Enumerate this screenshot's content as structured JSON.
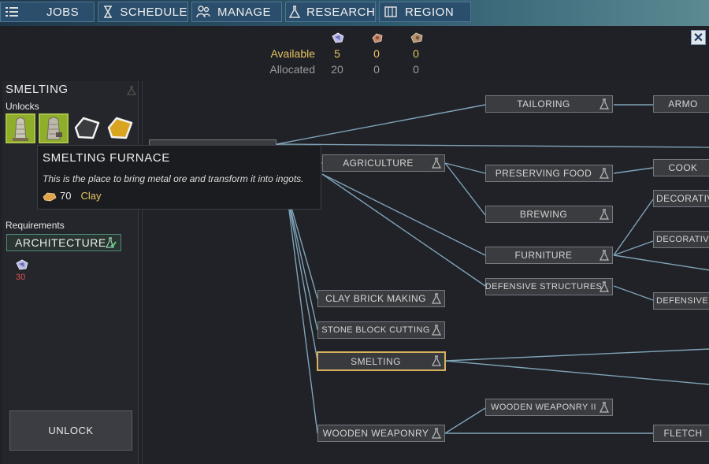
{
  "nav": {
    "items": [
      {
        "label": "JOBS",
        "icon": "list-icon"
      },
      {
        "label": "SCHEDULE",
        "icon": "hourglass-icon"
      },
      {
        "label": "MANAGE",
        "icon": "people-icon"
      },
      {
        "label": "RESEARCH",
        "icon": "flask-icon"
      },
      {
        "label": "REGION",
        "icon": "map-icon"
      }
    ]
  },
  "resources": {
    "available_label": "Available",
    "allocated_label": "Allocated",
    "columns": [
      {
        "icon": "research-points-icon",
        "available": "5",
        "allocated": "20"
      },
      {
        "icon": "copper-ore-icon",
        "available": "0",
        "allocated": "0"
      },
      {
        "icon": "iron-ore-icon",
        "available": "0",
        "allocated": "0"
      }
    ]
  },
  "close_symbol": "✕",
  "left_panel": {
    "title": "SMELTING",
    "unlocks_label": "Unlocks",
    "requirements_label": "Requirements",
    "requirement": "ARCHITECTURE",
    "requirement_cost": "30",
    "unlock_button": "UNLOCK"
  },
  "tooltip": {
    "title": "SMELTING FURNACE",
    "description": "This is the place to bring metal ore and transform it into ingots.",
    "cost_amount": "70",
    "cost_resource": "Clay"
  },
  "tree": {
    "nodes": {
      "tailoring": "TAILORING",
      "armor": "ARMO",
      "agriculture": "AGRICULTURE",
      "preserving_food": "PRESERVING FOOD",
      "cook": "COOK",
      "brewing": "BREWING",
      "decorative1": "DECORATIV",
      "decorative2": "DECORATIVE S",
      "furniture": "FURNITURE",
      "defensive_structures": "DEFENSIVE STRUCTURES",
      "defensive2": "DEFENSIVE ST",
      "clay_brick": "CLAY BRICK MAKING",
      "stone_block": "STONE BLOCK CUTTING",
      "smelting": "SMELTING",
      "wooden_weaponry_ii": "WOODEN WEAPONRY II",
      "wooden_weaponry": "WOODEN WEAPONRY",
      "fletch": "FLETCH"
    }
  },
  "colors": {
    "line": "#7fa3b8",
    "selected_border": "#d7b15d",
    "available": "#e5c360",
    "requirement_border": "#4e8a75",
    "cost_red": "#e05050"
  }
}
